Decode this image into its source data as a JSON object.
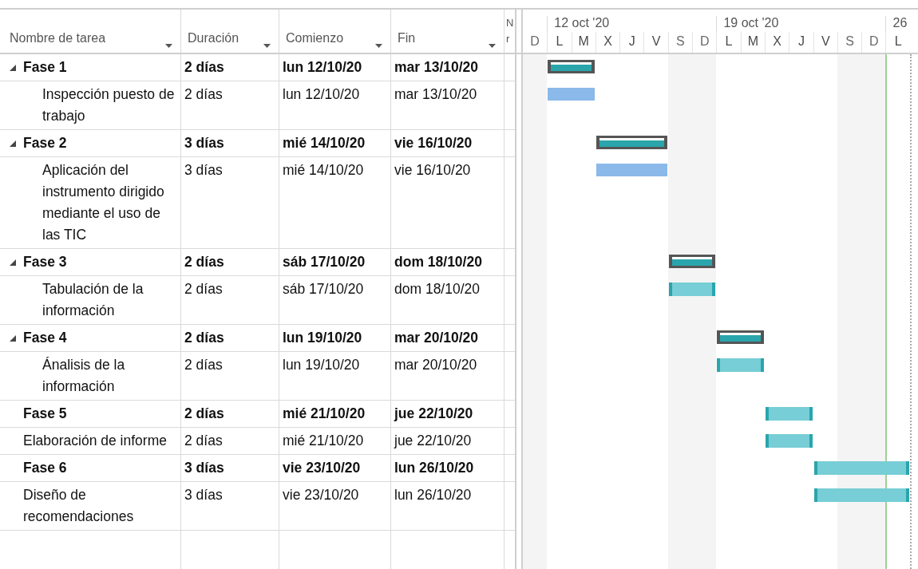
{
  "columns": [
    {
      "label": "Nombre de tarea"
    },
    {
      "label": "Duración"
    },
    {
      "label": "Comienzo"
    },
    {
      "label": "Fin"
    }
  ],
  "column_5": {
    "label": "N r"
  },
  "timeline": {
    "weeks": [
      "12 oct '20",
      "19 oct '20",
      "26"
    ],
    "days": [
      {
        "label": "D",
        "weekend": true
      },
      {
        "label": "L",
        "weekend": false
      },
      {
        "label": "M",
        "weekend": false
      },
      {
        "label": "X",
        "weekend": false
      },
      {
        "label": "J",
        "weekend": false
      },
      {
        "label": "V",
        "weekend": false
      },
      {
        "label": "S",
        "weekend": true
      },
      {
        "label": "D",
        "weekend": true
      },
      {
        "label": "L",
        "weekend": false
      },
      {
        "label": "M",
        "weekend": false
      },
      {
        "label": "X",
        "weekend": false
      },
      {
        "label": "J",
        "weekend": false
      },
      {
        "label": "V",
        "weekend": false
      },
      {
        "label": "S",
        "weekend": true
      },
      {
        "label": "D",
        "weekend": true
      },
      {
        "label": "L",
        "weekend": false
      }
    ]
  },
  "tasks": [
    {
      "kind": "summary",
      "name": "Fase 1",
      "duration": "2 días",
      "start": "lun 12/10/20",
      "end": "mar 13/10/20",
      "expanded": true,
      "bar": {
        "kind": "summary"
      },
      "children": [
        {
          "kind": "task",
          "bold": false,
          "name": "Inspección puesto de trabajo",
          "duration": "2 días",
          "start": "lun 12/10/20",
          "end": "mar 13/10/20",
          "bar": {
            "kind": "blue"
          }
        }
      ]
    },
    {
      "kind": "summary",
      "name": "Fase 2",
      "duration": "3 días",
      "start": "mié 14/10/20",
      "end": "vie 16/10/20",
      "expanded": true,
      "bar": {
        "kind": "summary"
      },
      "children": [
        {
          "kind": "task",
          "bold": false,
          "name": "Aplicación del instrumento dirigido mediante el uso de las TIC",
          "duration": "3 días",
          "start": "mié 14/10/20",
          "end": "vie 16/10/20",
          "bar": {
            "kind": "blue"
          }
        }
      ]
    },
    {
      "kind": "summary",
      "name": "Fase 3",
      "duration": "2 días",
      "start": "sáb 17/10/20",
      "end": "dom 18/10/20",
      "expanded": true,
      "bar": {
        "kind": "summary"
      },
      "children": [
        {
          "kind": "task",
          "bold": false,
          "name": "Tabulación de la información",
          "duration": "2 días",
          "start": "sáb 17/10/20",
          "end": "dom 18/10/20",
          "bar": {
            "kind": "teal"
          }
        }
      ]
    },
    {
      "kind": "summary",
      "name": "Fase 4",
      "duration": "2 días",
      "start": "lun 19/10/20",
      "end": "mar 20/10/20",
      "expanded": true,
      "bar": {
        "kind": "summary"
      },
      "children": [
        {
          "kind": "task",
          "bold": false,
          "name": "Ánalisis de la información",
          "duration": "2 días",
          "start": "lun 19/10/20",
          "end": "mar 20/10/20",
          "bar": {
            "kind": "teal"
          }
        }
      ]
    },
    {
      "kind": "task",
      "bold": true,
      "name": "Fase 5",
      "duration": "2 días",
      "start": "mié 21/10/20",
      "end": "jue 22/10/20",
      "bar": {
        "kind": "teal"
      }
    },
    {
      "kind": "task",
      "bold": false,
      "name": "Elaboración de informe",
      "duration": "2 días",
      "start": "mié 21/10/20",
      "end": "jue 22/10/20",
      "bar": {
        "kind": "teal"
      }
    },
    {
      "kind": "task",
      "bold": true,
      "name": "Fase 6",
      "duration": "3 días",
      "start": "vie 23/10/20",
      "end": "lun 26/10/20",
      "bar": {
        "kind": "teal"
      }
    },
    {
      "kind": "task",
      "bold": false,
      "name": "Diseño de recomendaciones",
      "duration": "3 días",
      "start": "vie 23/10/20",
      "end": "lun 26/10/20",
      "bar": {
        "kind": "teal"
      }
    }
  ]
}
